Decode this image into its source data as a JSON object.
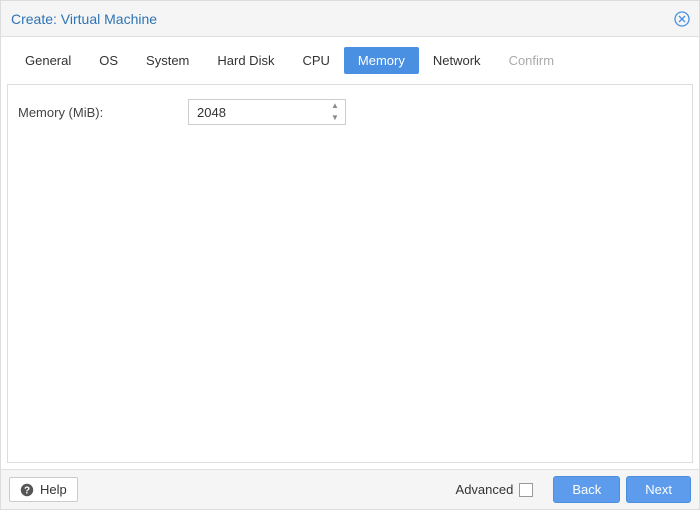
{
  "window": {
    "title": "Create: Virtual Machine"
  },
  "tabs": {
    "general": "General",
    "os": "OS",
    "system": "System",
    "harddisk": "Hard Disk",
    "cpu": "CPU",
    "memory": "Memory",
    "network": "Network",
    "confirm": "Confirm"
  },
  "form": {
    "memory_label": "Memory (MiB):",
    "memory_value": "2048"
  },
  "footer": {
    "help": "Help",
    "advanced": "Advanced",
    "back": "Back",
    "next": "Next"
  }
}
